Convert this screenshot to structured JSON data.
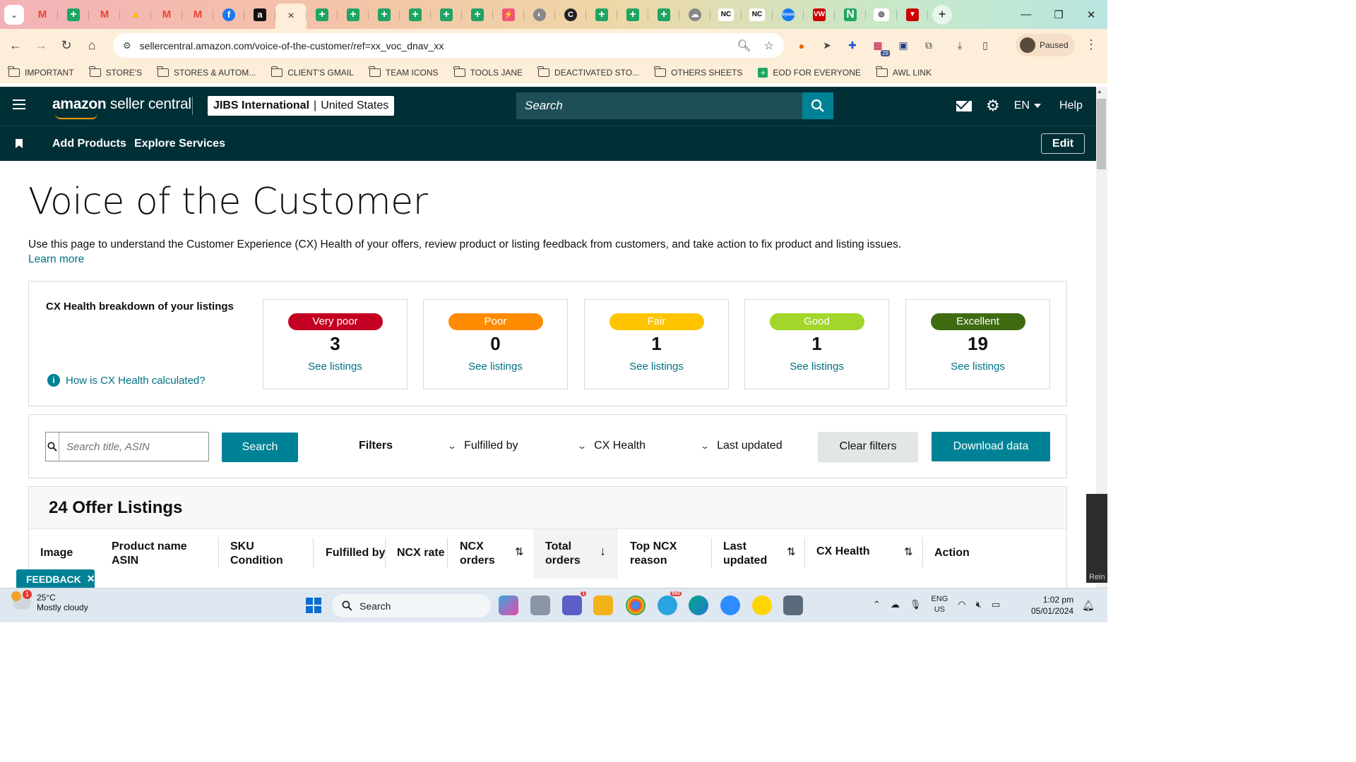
{
  "browser": {
    "tabs": [
      {
        "icon": "gmail-icon",
        "glyph": "M"
      },
      {
        "icon": "sheets-icon",
        "glyph": "+"
      },
      {
        "icon": "gmail-icon",
        "glyph": "M"
      },
      {
        "icon": "drive-icon",
        "glyph": "▲"
      },
      {
        "icon": "gmail-icon",
        "glyph": "M"
      },
      {
        "icon": "gmail-icon",
        "glyph": "M"
      },
      {
        "icon": "facebook-icon",
        "glyph": "f"
      },
      {
        "icon": "amazon-icon",
        "glyph": "a"
      },
      {
        "icon": "active-tab-close-icon",
        "glyph": "×"
      },
      {
        "icon": "sheets-icon",
        "glyph": "+"
      },
      {
        "icon": "sheets-icon",
        "glyph": "+"
      },
      {
        "icon": "sheets-icon",
        "glyph": "+"
      },
      {
        "icon": "sheets-icon",
        "glyph": "+"
      },
      {
        "icon": "sheets-icon",
        "glyph": "+"
      },
      {
        "icon": "sheets-icon",
        "glyph": "+"
      },
      {
        "icon": "zapier-icon",
        "glyph": "⚡"
      },
      {
        "icon": "globe-icon",
        "glyph": "◐"
      },
      {
        "icon": "c-logo-icon",
        "glyph": "C"
      },
      {
        "icon": "sheets-icon",
        "glyph": "+"
      },
      {
        "icon": "sheets-icon",
        "glyph": "+"
      },
      {
        "icon": "sheets-icon",
        "glyph": "+"
      },
      {
        "icon": "cloud-app-icon",
        "glyph": "☁"
      },
      {
        "icon": "nc-icon",
        "glyph": "NC"
      },
      {
        "icon": "nc-icon",
        "glyph": "NC"
      },
      {
        "icon": "sysco-icon",
        "glyph": "Sysco"
      },
      {
        "icon": "vw-icon",
        "glyph": "VW"
      },
      {
        "icon": "n-logo-icon",
        "glyph": "N"
      },
      {
        "icon": "circle-logo-icon",
        "glyph": "◎"
      },
      {
        "icon": "triangle-logo-icon",
        "glyph": "▼"
      }
    ],
    "url": "sellercentral.amazon.com/voice-of-the-customer/ref=xx_voc_dnav_xx",
    "profile_label": "Paused",
    "extension_badge": "29",
    "bookmarks": [
      {
        "label": "IMPORTANT",
        "type": "folder"
      },
      {
        "label": "STORE'S",
        "type": "folder"
      },
      {
        "label": "STORES & AUTOM...",
        "type": "folder"
      },
      {
        "label": "CLIENT'S GMAIL",
        "type": "folder"
      },
      {
        "label": "TEAM ICONS",
        "type": "folder"
      },
      {
        "label": "TOOLS JANE",
        "type": "folder"
      },
      {
        "label": "DEACTIVATED STO...",
        "type": "folder"
      },
      {
        "label": "OTHERS SHEETS",
        "type": "folder"
      },
      {
        "label": "EOD FOR EVERYONE",
        "type": "sheet"
      },
      {
        "label": "AWL LINK",
        "type": "folder"
      }
    ]
  },
  "header": {
    "logo_bold": "amazon",
    "logo_rest": " seller central",
    "store_name": "JIBS International",
    "store_separator": "|",
    "store_region": "United States",
    "search_placeholder": "Search",
    "language": "EN",
    "help": "Help"
  },
  "subnav": {
    "add_products": "Add Products",
    "explore_services": "Explore Services",
    "edit": "Edit"
  },
  "page": {
    "title": "Voice of the Customer",
    "description": "Use this page to understand the Customer Experience (CX) Health of your offers, review product or listing feedback from customers, and take action to fix product and listing issues.",
    "learn_more": "Learn more"
  },
  "cx_health": {
    "heading": "CX Health breakdown of your listings",
    "how_calculated": "How is CX Health calculated?",
    "cards": [
      {
        "label": "Very poor",
        "count": "3",
        "link": "See listings",
        "color": "#c40022"
      },
      {
        "label": "Poor",
        "count": "0",
        "link": "See listings",
        "color": "#ff8c00"
      },
      {
        "label": "Fair",
        "count": "1",
        "link": "See listings",
        "color": "#ffc400"
      },
      {
        "label": "Good",
        "count": "1",
        "link": "See listings",
        "color": "#a3d52a"
      },
      {
        "label": "Excellent",
        "count": "19",
        "link": "See listings",
        "color": "#3f6b12"
      }
    ]
  },
  "filters": {
    "search_placeholder": "Search title, ASIN",
    "search_button": "Search",
    "filters_label": "Filters",
    "fulfilled_by": "Fulfilled by",
    "cx_health": "CX Health",
    "last_updated": "Last updated",
    "clear_filters": "Clear filters",
    "download_data": "Download data"
  },
  "listings": {
    "title": "24 Offer Listings",
    "columns": {
      "image": "Image",
      "product_name": "Product name",
      "asin": "ASIN",
      "sku": "SKU",
      "condition": "Condition",
      "fulfilled_by": "Fulfilled by",
      "ncx_rate": "NCX rate",
      "ncx": "NCX",
      "orders": "orders",
      "total": "Total",
      "top_ncx": "Top NCX",
      "reason": "reason",
      "last": "Last",
      "updated": "updated",
      "cx_health": "CX Health",
      "action": "Action"
    }
  },
  "feedback": "FEEDBACK",
  "side_thumb_label": "Rein",
  "taskbar": {
    "temperature": "25°C",
    "weather": "Mostly cloudy",
    "weather_badge": "1",
    "search": "Search",
    "teams_badge": "1",
    "telegram_badge": "592",
    "lang_line1": "ENG",
    "lang_line2": "US",
    "time": "1:02 pm",
    "date": "05/01/2024"
  }
}
